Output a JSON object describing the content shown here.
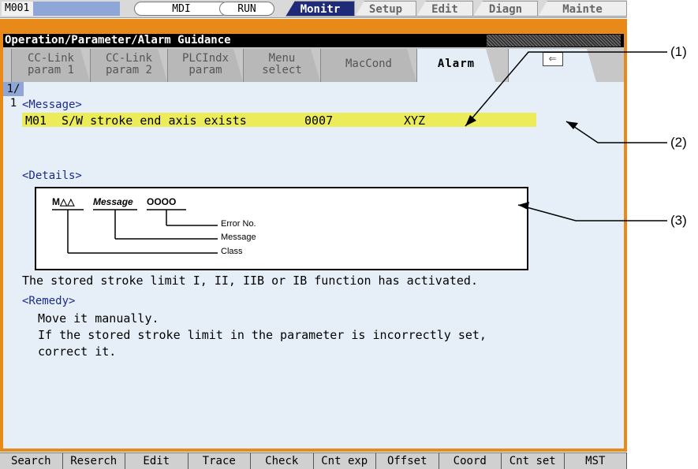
{
  "status_bar": {
    "machine_id": "M001",
    "mode": "MDI",
    "run_state": "RUN",
    "function_tabs": [
      "Monitr",
      "Setup",
      "Edit",
      "Diagn",
      "Mainte"
    ],
    "active_function": "Monitr"
  },
  "screen_title": "Operation/Parameter/Alarm Guidance",
  "tabs": [
    {
      "line1": "CC-Link",
      "line2": "param 1"
    },
    {
      "line1": "CC-Link",
      "line2": "param 2"
    },
    {
      "line1": "PLCIndx",
      "line2": "param"
    },
    {
      "line1": "Menu",
      "line2": "select"
    },
    {
      "line1": "MacCond",
      "line2": ""
    },
    {
      "line1": "Alarm",
      "line2": ""
    }
  ],
  "active_tab": "Alarm",
  "back_tab_icon": "return-arrow-icon",
  "message_section": {
    "header": "<Message>",
    "page_indicator": "1/ 1",
    "alarm_code": "M01",
    "alarm_text": "S/W stroke end axis exists",
    "alarm_number": "0007",
    "alarm_axes": "XYZ",
    "highlight_color": "#ecec5a"
  },
  "details_section": {
    "header": "<Details>",
    "diagram": {
      "field_class": "M△△",
      "field_message": "Message",
      "field_error": "OOOO",
      "label_error_no": "Error No.",
      "label_message": "Message",
      "label_class": "Class"
    },
    "description": "The stored stroke limit I, II, IIB or IB function has activated."
  },
  "remedy_section": {
    "header": "<Remedy>",
    "lines": [
      "Move it manually.",
      "If the stored stroke limit in the parameter is incorrectly set,",
      "correct it."
    ]
  },
  "softkeys": [
    "Search",
    "Reserch",
    "Edit",
    "Trace",
    "Check",
    "Cnt exp",
    "Offset",
    "Coord",
    "Cnt set",
    "MST"
  ],
  "callouts": [
    "(1)",
    "(2)",
    "(3)"
  ],
  "colors": {
    "frame": "#e88a1a",
    "content_bg": "#e6eff8",
    "active_function_tab": "#1f2a78",
    "page_indicator_bg": "#8ea7d6"
  }
}
